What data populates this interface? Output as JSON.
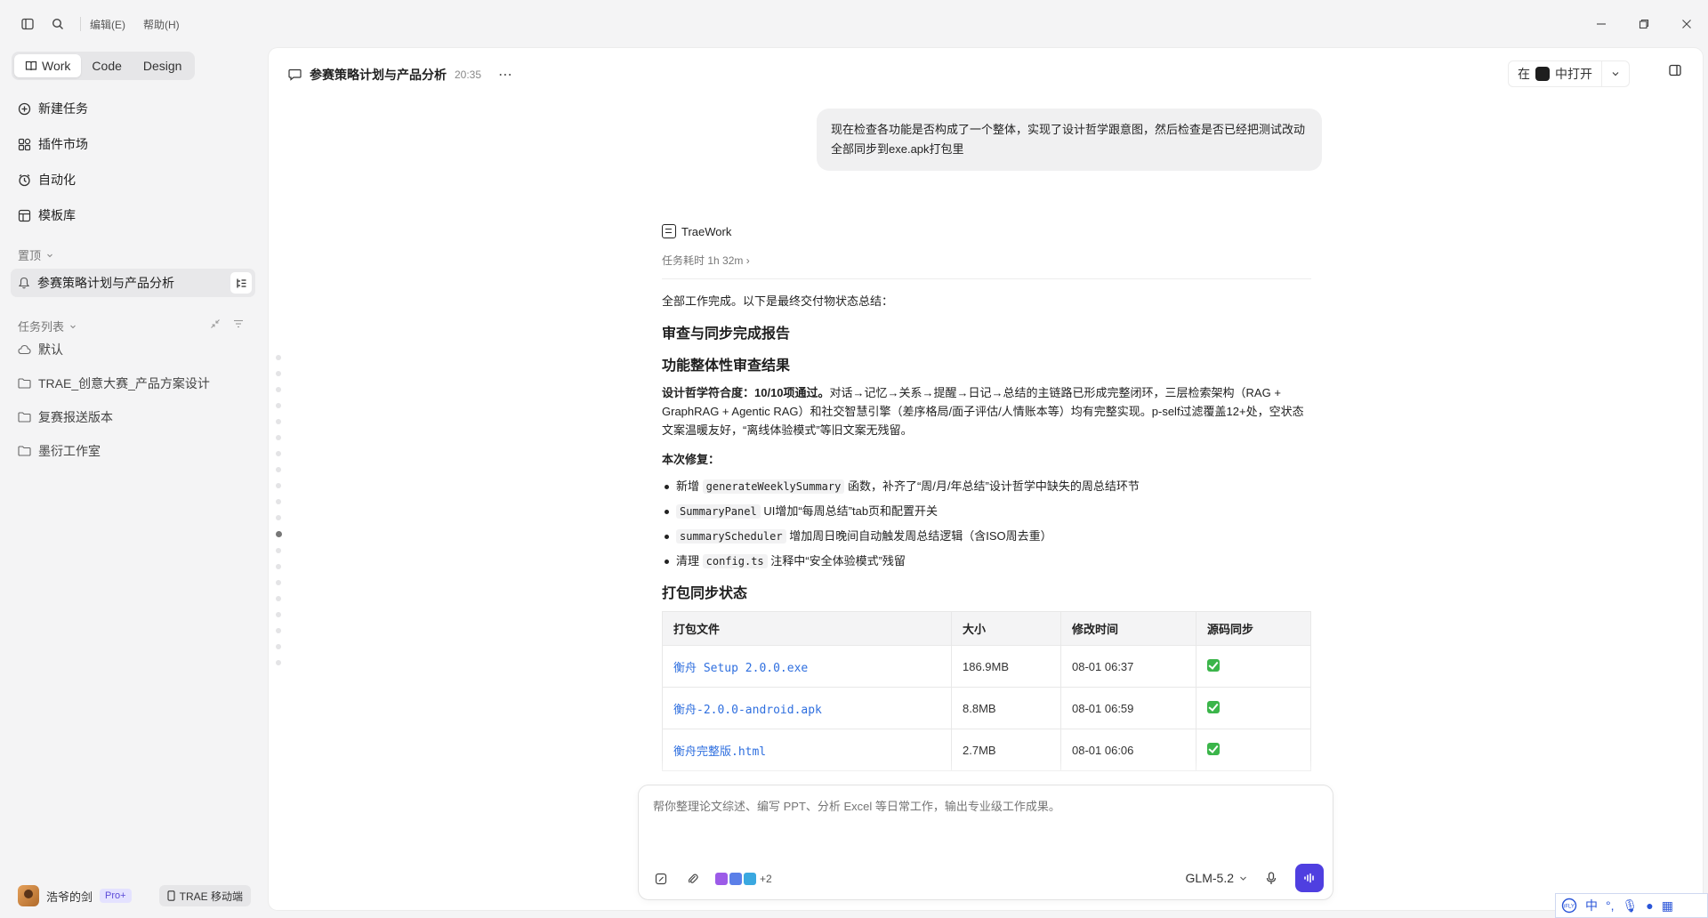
{
  "titlebar": {
    "menus": [
      "编辑(E)",
      "帮助(H)"
    ]
  },
  "sidebar": {
    "modes": [
      "Work",
      "Code",
      "Design"
    ],
    "nav": [
      {
        "label": "新建任务",
        "icon": "new-task-icon"
      },
      {
        "label": "插件市场",
        "icon": "plugin-icon"
      },
      {
        "label": "自动化",
        "icon": "clock-icon"
      },
      {
        "label": "模板库",
        "icon": "template-icon"
      }
    ],
    "pinned_header": "置顶",
    "pinned_item": "参赛策略计划与产品分析",
    "tasks_header": "任务列表",
    "tasks": [
      "默认",
      "TRAE_创意大赛_产品方案设计",
      "复赛报送版本",
      "墨衍工作室"
    ],
    "user": {
      "name": "浩爷的剑",
      "badge": "Pro+",
      "mobile": "TRAE 移动端"
    }
  },
  "main": {
    "title": "参赛策略计划与产品分析",
    "time": "20:35",
    "open_in_prefix": "在",
    "open_in_label": "中打开",
    "user_message": "现在检查各功能是否构成了一个整体，实现了设计哲学跟意图，然后检查是否已经把测试改动全部同步到exe.apk打包里",
    "agent_name": "TraeWork",
    "duration": "任务耗时 1h 32m ›",
    "intro": "全部工作完成。以下是最终交付物状态总结：",
    "h_report": "审查与同步完成报告",
    "h_section": "功能整体性审查结果",
    "para_bold": "设计哲学符合度：10/10项通过。",
    "para_rest": "对话→记忆→关系→提醒→日记→总结的主链路已形成完整闭环，三层检索架构（RAG + GraphRAG + Agentic RAG）和社交智慧引擎（差序格局/面子评估/人情账本等）均有完整实现。p-self过滤覆盖12+处，空状态文案温暖友好，“离线体验模式”等旧文案无残留。",
    "fix_head": "本次修复：",
    "fixes": [
      {
        "pre": "新增 ",
        "code": "generateWeeklySummary",
        "post": " 函数，补齐了“周/月/年总结”设计哲学中缺失的周总结环节"
      },
      {
        "pre": "",
        "code": "SummaryPanel",
        "post": " UI增加“每周总结”tab页和配置开关"
      },
      {
        "pre": "",
        "code": "summaryScheduler",
        "post": " 增加周日晚间自动触发周总结逻辑（含ISO周去重）"
      },
      {
        "pre": "清理 ",
        "code": "config.ts",
        "post": " 注释中“安全体验模式”残留"
      }
    ],
    "h_pack": "打包同步状态",
    "table": {
      "headers": [
        "打包文件",
        "大小",
        "修改时间",
        "源码同步"
      ],
      "rows": [
        {
          "file": "衡舟 Setup 2.0.0.exe",
          "size": "186.9MB",
          "time": "08-01 06:37"
        },
        {
          "file": "衡舟-2.0.0-android.apk",
          "size": "8.8MB",
          "time": "08-01 06:59"
        },
        {
          "file": "衡舟完整版.html",
          "size": "2.7MB",
          "time": "08-01 06:06"
        }
      ]
    },
    "composer": {
      "placeholder": "帮你整理论文综述、编写 PPT、分析 Excel 等日常工作，输出专业级工作成果。",
      "plugins_more": "+2",
      "model": "GLM-5.2"
    }
  },
  "colors": {
    "accent": "#4f3fe0",
    "link": "#2f6fdf",
    "check": "#3bb54a"
  },
  "ime": {
    "chinese": "中"
  }
}
